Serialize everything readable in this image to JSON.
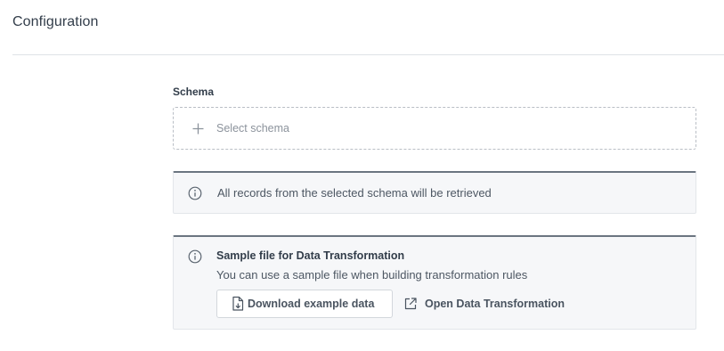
{
  "header": {
    "title": "Configuration"
  },
  "schema": {
    "label": "Schema",
    "select_placeholder": "Select schema"
  },
  "notice_records": {
    "text": "All records from the selected schema will be retrieved"
  },
  "notice_sample": {
    "title": "Sample file for Data Transformation",
    "description": "You can use a sample file when building transformation rules",
    "download_label": "Download example data",
    "open_label": "Open Data Transformation"
  },
  "colors": {
    "notice_background": "#f6f7f9",
    "notice_top_border": "#6b7580",
    "text_primary": "#323d4a",
    "text_muted": "#8c939c"
  },
  "icons": {
    "add": "plus-icon",
    "info": "info-icon",
    "download": "file-download-icon",
    "external": "external-link-icon"
  }
}
